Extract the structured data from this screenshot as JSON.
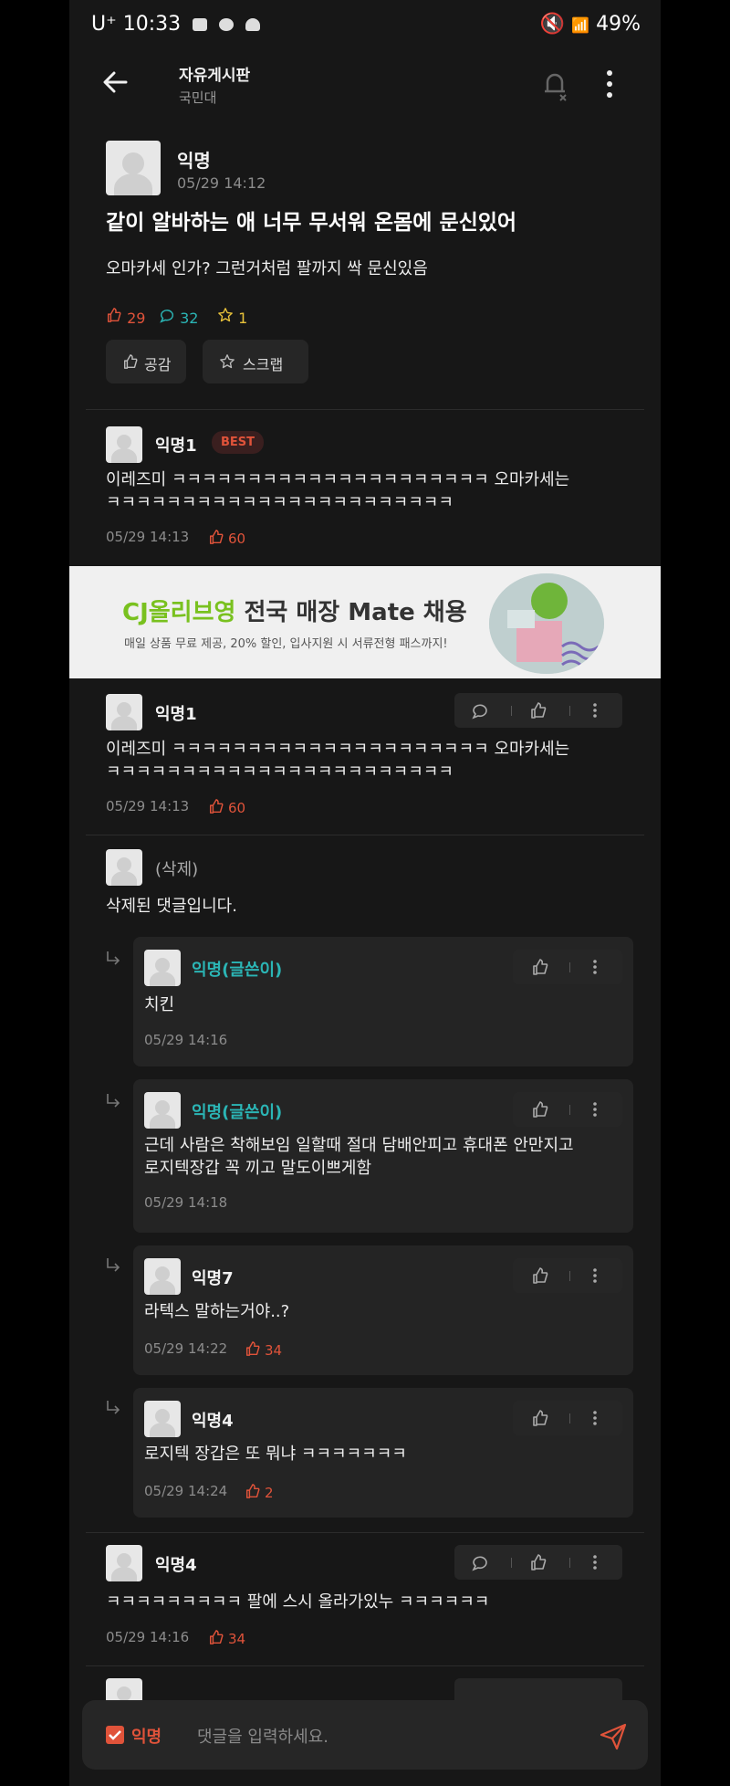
{
  "status_bar": {
    "carrier": "U⁺",
    "time": "10:33",
    "battery": "49%"
  },
  "header": {
    "board_title": "자유게시판",
    "board_subtitle": "국민대"
  },
  "post": {
    "author": "익명",
    "date": "05/29 14:12",
    "title": "같이 알바하는 애 너무 무서워 온몸에 문신있어",
    "body": "오마카세 인가? 그런거처럼 팔까지 싹 문신있음",
    "likes": "29",
    "comments": "32",
    "scraps": "1",
    "like_button": "공감",
    "scrap_button": "스크랩"
  },
  "best_comment": {
    "author": "익명1",
    "badge": "BEST",
    "body": "이레즈미 ㅋㅋㅋㅋㅋㅋㅋㅋㅋㅋㅋㅋㅋㅋㅋㅋㅋㅋㅋㅋㅋ 오마카세는\nㅋㅋㅋㅋㅋㅋㅋㅋㅋㅋㅋㅋㅋㅋㅋㅋㅋㅋㅋㅋㅋㅋㅋ",
    "date": "05/29 14:13",
    "likes": "60"
  },
  "ad": {
    "brand": "CJ올리브영",
    "headline": " 전국 매장 Mate 채용",
    "subline": "매일 상품 무료 제공, 20% 할인, 입사지원 시 서류전형 패스까지!"
  },
  "comments": [
    {
      "author": "익명1",
      "body": "이레즈미 ㅋㅋㅋㅋㅋㅋㅋㅋㅋㅋㅋㅋㅋㅋㅋㅋㅋㅋㅋㅋㅋ 오마카세는\nㅋㅋㅋㅋㅋㅋㅋㅋㅋㅋㅋㅋㅋㅋㅋㅋㅋㅋㅋㅋㅋㅋㅋ",
      "date": "05/29 14:13",
      "likes": "60"
    },
    {
      "author": "(삭제)",
      "body": "삭제된 댓글입니다."
    }
  ],
  "replies": [
    {
      "author": "익명(글쓴이)",
      "body": "치킨",
      "date": "05/29 14:16",
      "likes": ""
    },
    {
      "author": "익명(글쓴이)",
      "body": "근데 사람은 착해보임 일할때 절대 담배안피고 휴대폰 안만지고\n로지텍장갑 꼭 끼고 말도이쁘게함",
      "date": "05/29 14:18",
      "likes": ""
    },
    {
      "author": "익명7",
      "body": "라텍스 말하는거야..?",
      "date": "05/29 14:22",
      "likes": "34"
    },
    {
      "author": "익명4",
      "body": "로지텍 장갑은 또 뭐냐 ㅋㅋㅋㅋㅋㅋㅋ",
      "date": "05/29 14:24",
      "likes": "2"
    }
  ],
  "last_comment": {
    "author": "익명4",
    "body": "ㅋㅋㅋㅋㅋㅋㅋㅋㅋ 팔에 스시 올라가있누 ㅋㅋㅋㅋㅋㅋ",
    "date": "05/29 14:16",
    "likes": "34"
  },
  "input_bar": {
    "anonymous_label": "익명",
    "placeholder": "댓글을 입력하세요."
  },
  "colors": {
    "accent_red": "#e0533a",
    "op_teal": "#2bb5b5",
    "background": "#171717"
  }
}
